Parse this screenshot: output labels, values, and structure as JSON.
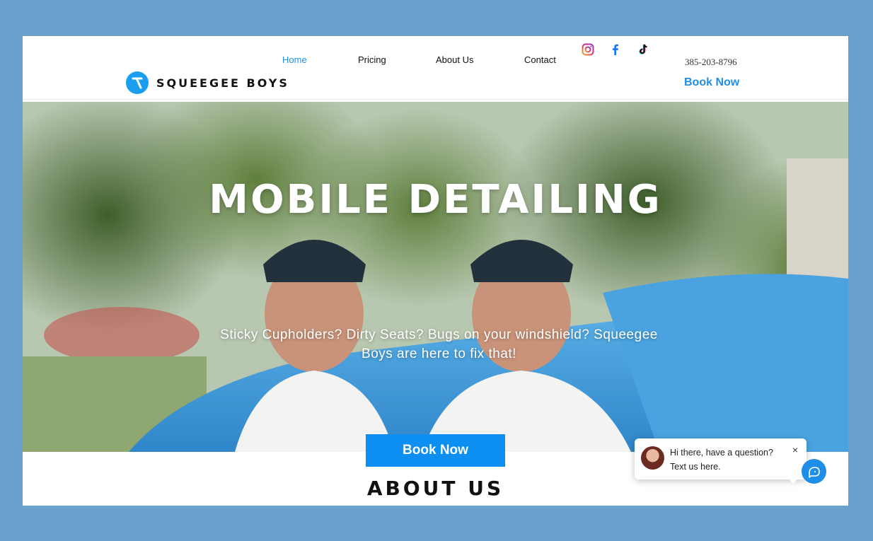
{
  "nav": {
    "items": [
      {
        "label": "Home",
        "active": true
      },
      {
        "label": "Pricing"
      },
      {
        "label": "About Us"
      },
      {
        "label": "Contact"
      }
    ]
  },
  "brand": {
    "name": "SQUEEGEE BOYS"
  },
  "header": {
    "phone": "385-203-8796",
    "book_label": "Book Now"
  },
  "social": [
    "instagram-icon",
    "facebook-icon",
    "tiktok-icon"
  ],
  "hero": {
    "title": "MOBILE DETAILING",
    "subtitle": "Sticky Cupholders? Dirty Seats? Bugs on your windshield? Squeegee Boys are here to fix that!",
    "button_label": "Book Now"
  },
  "about": {
    "title": "ABOUT US"
  },
  "chat": {
    "line1": "Hi there, have a question?",
    "line2": "Text us here.",
    "close": "×"
  },
  "colors": {
    "accent": "#1f8ee8",
    "page_bg": "#6aa0cc",
    "button": "#0d8ff2"
  }
}
